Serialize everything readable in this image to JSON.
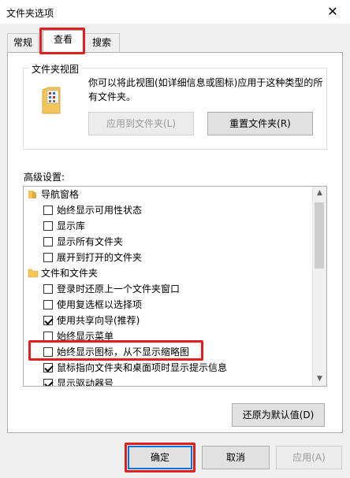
{
  "window": {
    "title": "文件夹选项",
    "close_glyph": "✕"
  },
  "tabs": [
    {
      "label": "常规",
      "active": false
    },
    {
      "label": "查看",
      "active": true
    },
    {
      "label": "搜索",
      "active": false
    }
  ],
  "folder_views": {
    "group_label": "文件夹视图",
    "description": "你可以将此视图(如详细信息或图标)应用于这种类型的所有文件夹。",
    "apply_button": "应用到文件夹(L)",
    "reset_button": "重置文件夹(R)"
  },
  "advanced": {
    "label": "高级设置:",
    "items": [
      {
        "type": "category",
        "label": "导航窗格"
      },
      {
        "type": "check",
        "label": "始终显示可用性状态",
        "checked": false
      },
      {
        "type": "check",
        "label": "显示库",
        "checked": false
      },
      {
        "type": "check",
        "label": "显示所有文件夹",
        "checked": false
      },
      {
        "type": "check",
        "label": "展开到打开的文件夹",
        "checked": false
      },
      {
        "type": "category",
        "label": "文件和文件夹"
      },
      {
        "type": "check",
        "label": "登录时还原上一个文件夹窗口",
        "checked": false
      },
      {
        "type": "check",
        "label": "使用复选框以选择项",
        "checked": false
      },
      {
        "type": "check",
        "label": "使用共享向导(推荐)",
        "checked": true
      },
      {
        "type": "check",
        "label": "始终显示菜单",
        "checked": false
      },
      {
        "type": "check",
        "label": "始终显示图标，从不显示缩略图",
        "checked": false
      },
      {
        "type": "check",
        "label": "鼠标指向文件夹和桌面项时显示提示信息",
        "checked": true
      },
      {
        "type": "check",
        "label": "显示驱动器号",
        "checked": true
      }
    ],
    "restore_button": "还原为默认值(D)"
  },
  "footer": {
    "ok": "确定",
    "cancel": "取消",
    "apply": "应用(A)"
  },
  "colors": {
    "highlight": "#e02020",
    "accent": "#0078d7",
    "folder": "#f3c55c"
  }
}
